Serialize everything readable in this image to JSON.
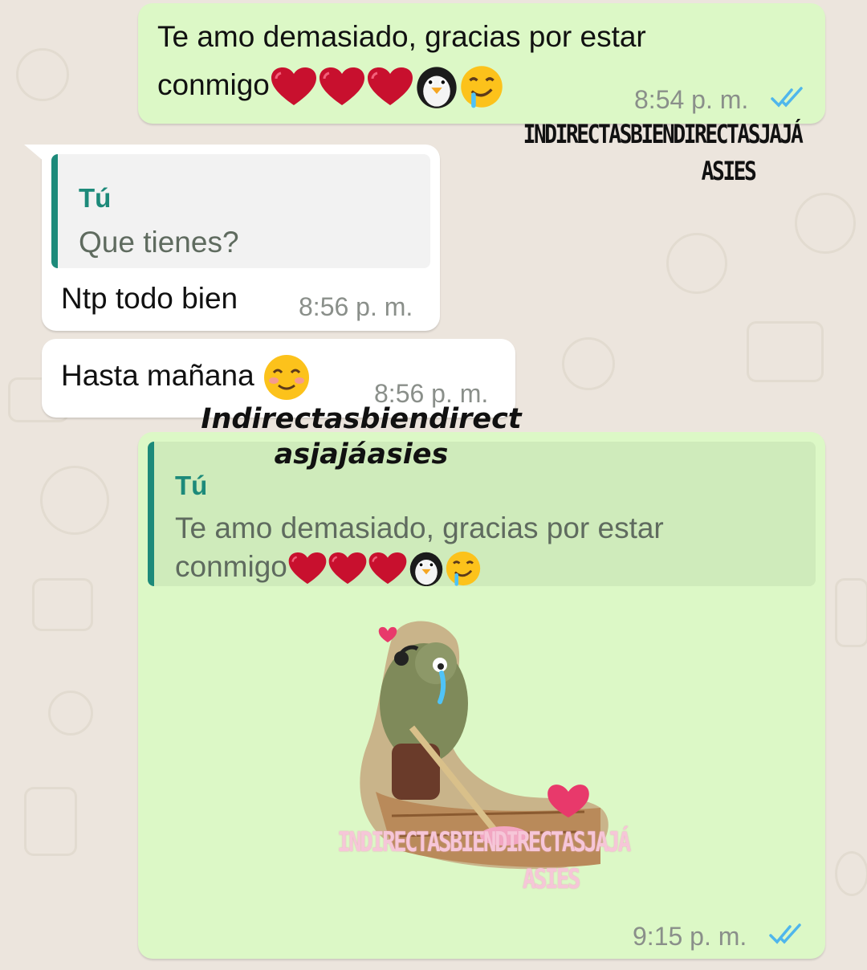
{
  "messages": [
    {
      "id": "m1",
      "direction": "outgoing",
      "text": "Te amo demasiado, gracias por estar",
      "text_line2": "conmigo",
      "emojis": [
        "red-heart",
        "red-heart",
        "red-heart",
        "penguin",
        "drooling-face"
      ],
      "time": "8:54 p. m.",
      "status": "read"
    },
    {
      "id": "m2",
      "direction": "incoming",
      "quoted": {
        "author": "Tú",
        "text": "Que tienes?"
      },
      "text": "Ntp todo bien",
      "time": "8:56 p. m."
    },
    {
      "id": "m3",
      "direction": "incoming",
      "text": "Hasta mañana",
      "emojis": [
        "smiling-face-with-smiling-eyes"
      ],
      "time": "8:56 p. m."
    },
    {
      "id": "m4",
      "direction": "outgoing",
      "quoted": {
        "author": "Tú",
        "text": "Te amo demasiado, gracias por estar",
        "text_line2": "conmigo",
        "emojis": [
          "red-heart",
          "red-heart",
          "red-heart",
          "penguin",
          "drooling-face"
        ]
      },
      "sticker": "crying-cartoon-fish-mopping-floor-sticker",
      "time": "9:15 p. m.",
      "status": "read"
    }
  ],
  "watermarks": {
    "caps_line1": "INDIRECTASBIENDIRECTASJAJÁ",
    "caps_line2": "ASIES",
    "italic_line1": "Indirectasbiendirect",
    "italic_line2": "asjajáasies",
    "pink_line1": "INDIRECTASBIENDIRECTASJAJÁ",
    "pink_line2": "ASIES"
  },
  "colors": {
    "outgoing_bubble": "#dcf8c6",
    "incoming_bubble": "#ffffff",
    "quote_accent": "#1d8a7a",
    "read_ticks": "#4fb6ec",
    "wallpaper": "#ece5dd"
  }
}
